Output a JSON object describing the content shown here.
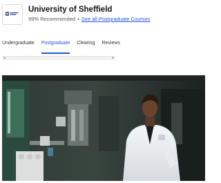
{
  "header": {
    "university_name": "University of Sheffield",
    "recommended": "99% Recommended",
    "separator": "•",
    "all_courses_link": "See all Postgraduate Courses"
  },
  "tabs": [
    {
      "label": "Undergraduate",
      "active": false
    },
    {
      "label": "Postgraduate",
      "active": true
    },
    {
      "label": "Clearing",
      "active": false
    },
    {
      "label": "Reviews",
      "active": false
    }
  ],
  "scrollbar": {
    "left_arrow": "◂",
    "right_arrow": "▸"
  },
  "colors": {
    "accent": "#1f57d6",
    "hero_bg": "#26302d"
  }
}
